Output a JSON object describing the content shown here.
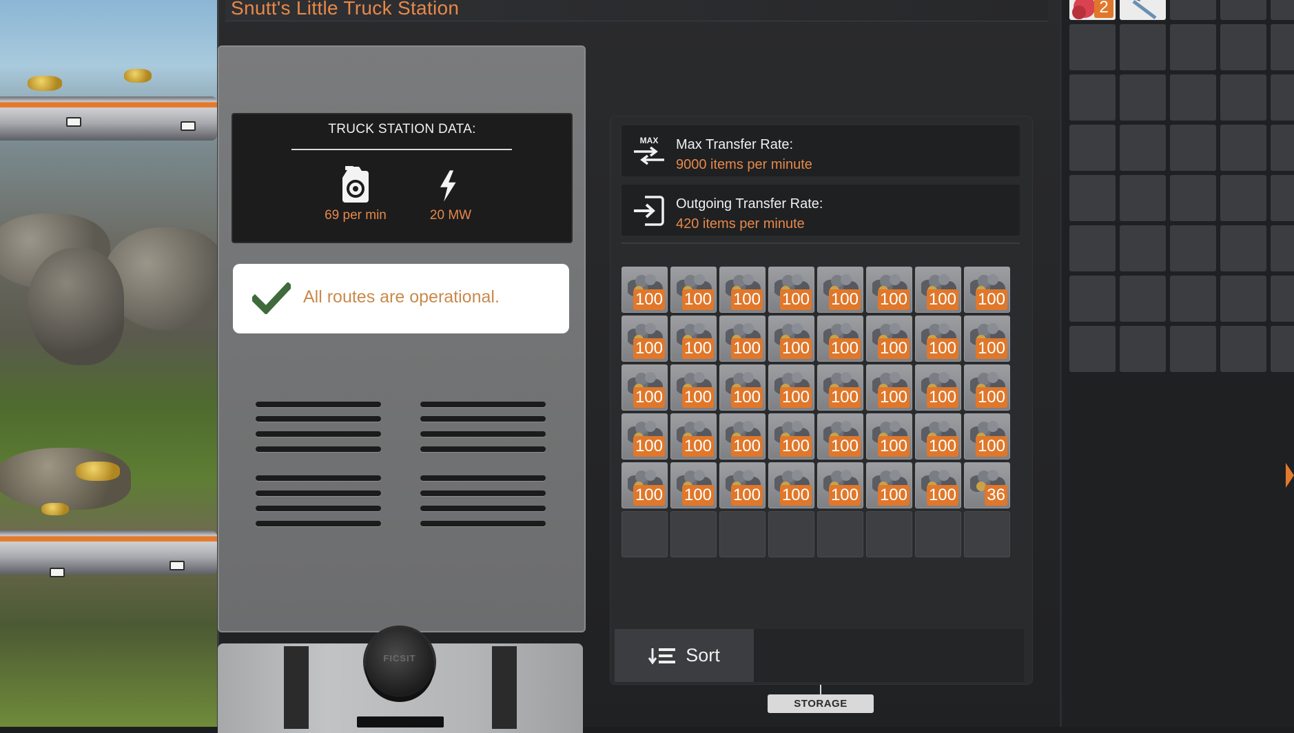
{
  "station": {
    "title": "Snutt's Little Truck Station"
  },
  "data_panel": {
    "title": "TRUCK STATION DATA:",
    "stats": [
      {
        "icon": "fuel-canister-icon",
        "value": "69 per min"
      },
      {
        "icon": "lightning-bolt-icon",
        "value": "20 MW"
      }
    ]
  },
  "status": {
    "icon": "checkmark-icon",
    "text": "All routes are operational."
  },
  "knob": {
    "text": "FICSIT"
  },
  "transfer": {
    "max": {
      "icon": "max-transfer-icon",
      "icon_text": "MAX",
      "label": "Max Transfer Rate:",
      "value": "9000 items per minute"
    },
    "outgoing": {
      "icon": "outgoing-transfer-icon",
      "label": "Outgoing Transfer Rate:",
      "value": "420 items per minute"
    }
  },
  "inventory": {
    "item_icon": "ore-icon",
    "columns": 8,
    "total_slots": 48,
    "counts": [
      "100",
      "100",
      "100",
      "100",
      "100",
      "100",
      "100",
      "100",
      "100",
      "100",
      "100",
      "100",
      "100",
      "100",
      "100",
      "100",
      "100",
      "100",
      "100",
      "100",
      "100",
      "100",
      "100",
      "100",
      "100",
      "100",
      "100",
      "100",
      "100",
      "100",
      "100",
      "100",
      "100",
      "100",
      "100",
      "100",
      "100",
      "100",
      "100",
      "36"
    ]
  },
  "sort": {
    "icon": "sort-icon",
    "label": "Sort"
  },
  "storage_tab": {
    "label": "STORAGE"
  },
  "player_inventory": {
    "slots": 40,
    "items": [
      {
        "slot": 0,
        "icon": "red-item-icon",
        "count": "2",
        "color": "#d9434f"
      },
      {
        "slot": 1,
        "icon": "tool-item-icon",
        "count": "",
        "color": "#6a8fb0"
      }
    ]
  },
  "colors": {
    "accent": "#e7894a",
    "count_badge": "#e0772a",
    "panel": "#2a2b2d"
  }
}
